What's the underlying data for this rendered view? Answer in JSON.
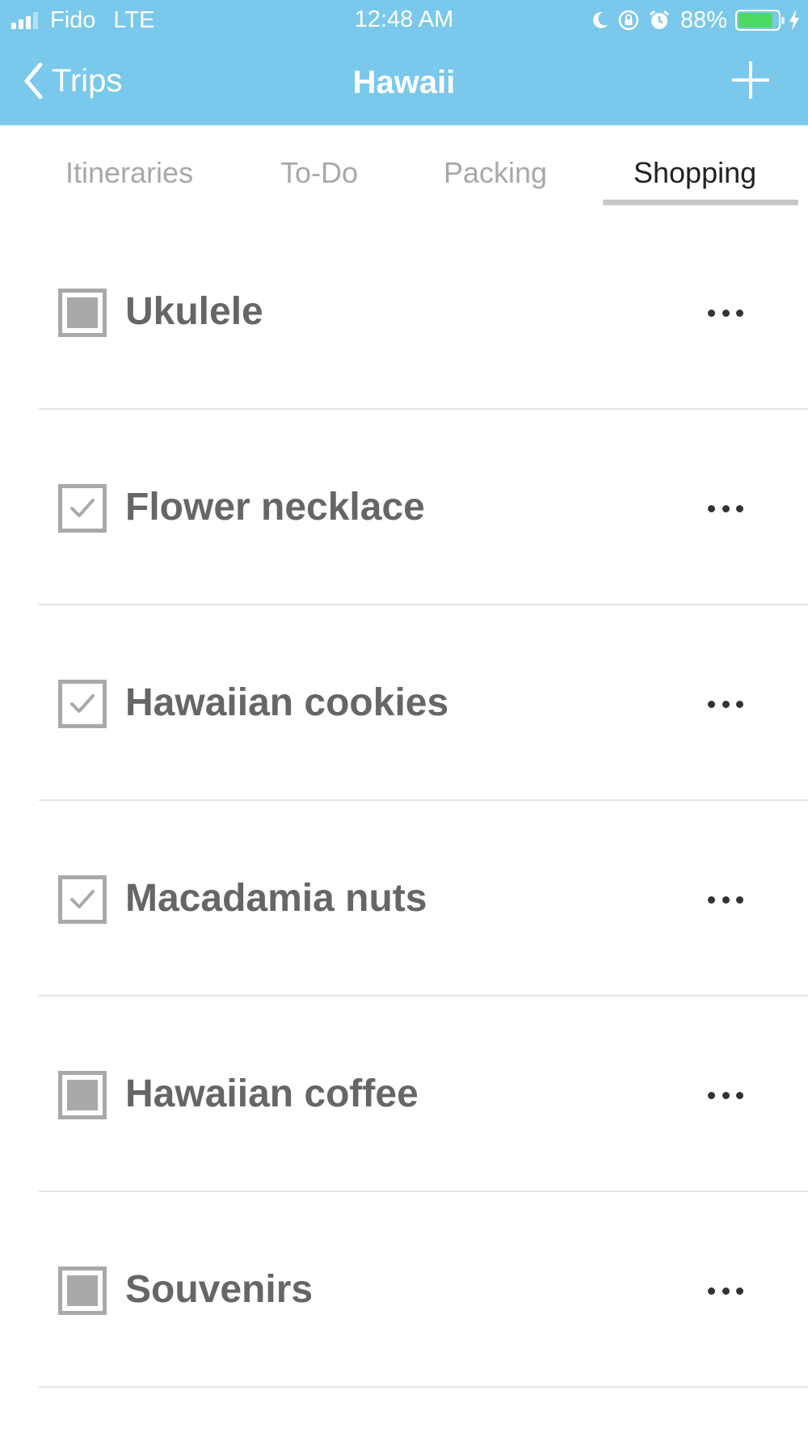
{
  "status_bar": {
    "carrier": "Fido",
    "network": "LTE",
    "time": "12:48 AM",
    "battery_percent": "88%",
    "battery_level": 0.88,
    "icons": [
      "signal-icon",
      "moon-icon",
      "rotation-lock-icon",
      "alarm-icon",
      "battery-icon",
      "charging-bolt-icon"
    ]
  },
  "nav": {
    "back_label": "Trips",
    "title": "Hawaii",
    "add_icon": "plus-icon"
  },
  "tabs": [
    {
      "label": "Itineraries",
      "active": false
    },
    {
      "label": "To-Do",
      "active": false
    },
    {
      "label": "Packing",
      "active": false
    },
    {
      "label": "Shopping",
      "active": true
    }
  ],
  "items": [
    {
      "label": "Ukulele",
      "checked": false
    },
    {
      "label": "Flower necklace",
      "checked": true
    },
    {
      "label": "Hawaiian cookies",
      "checked": true
    },
    {
      "label": "Macadamia nuts",
      "checked": true
    },
    {
      "label": "Hawaiian coffee",
      "checked": false
    },
    {
      "label": "Souvenirs",
      "checked": false
    }
  ],
  "colors": {
    "header": "#7ac8ec",
    "battery": "#4cd964",
    "checkbox": "#a9a9a9"
  }
}
